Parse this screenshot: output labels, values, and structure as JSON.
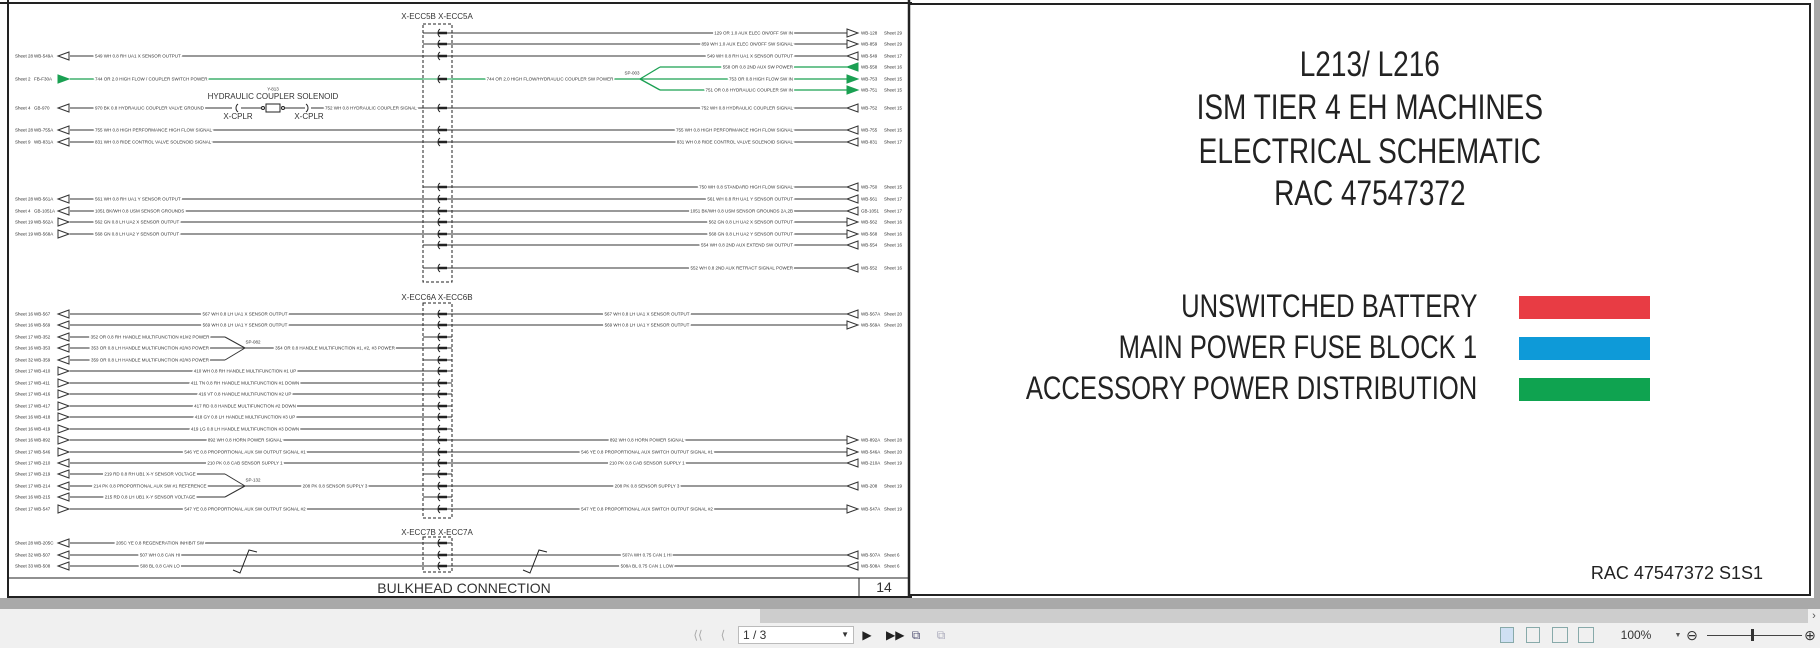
{
  "schematic": {
    "sections": [
      {
        "header": "X-ECC5B X-ECC5A",
        "rows": [
          {
            "right": {
              "wire": "129 OR 1.0 AUX ELEC ON/OFF SW IN",
              "ref": "WB-128",
              "sheet": "Sheet 29",
              "arrow": "out"
            }
          },
          {
            "right": {
              "wire": "859 WH 1.0 AUX ELEC ON/OFF SW SIGNAL",
              "ref": "WB-859",
              "sheet": "Sheet 29",
              "arrow": "out"
            }
          },
          {
            "left": {
              "wire": "549 WH 0.8 RH UA1 X SENSOR OUTPUT",
              "ref": "WB-549A",
              "sheet": "Sheet 28",
              "arrow": "in"
            },
            "right": {
              "wire": "549 WH 0.8 RH UA1 X SENSOR OUTPUT",
              "ref": "WB-549",
              "sheet": "Sheet 17",
              "arrow": "in"
            }
          },
          {
            "color": "green",
            "left": {
              "wire": "744 OR 2.0 HIGH FLOW / COUPLER SWITCH POWER",
              "ref": "FB-F30A",
              "sheet": "Sheet 2",
              "arrow": "fill-out"
            }
          },
          {
            "left": {
              "wire": "970 BK 0.8 HYDRAULIC COUPLER VALVE GROUND",
              "ref": "GB-970",
              "sheet": "Sheet 4",
              "arrow": "in"
            },
            "right": {
              "wire": "752 WH 0.8 HYDRAULIC COUPLER SIGNAL",
              "ref": "WB-752",
              "sheet": "Sheet 15",
              "arrow": "in"
            }
          },
          {
            "left": {
              "wire": "755 WH 0.8 HIGH PERFORMANCE HIGH FLOW SIGNAL",
              "ref": "WB-755A",
              "sheet": "Sheet 28",
              "arrow": "in"
            },
            "right": {
              "wire": "755 WH 0.8 HIGH PERFORMANCE HIGH FLOW SIGNAL",
              "ref": "WB-755",
              "sheet": "Sheet 15",
              "arrow": "in"
            }
          },
          {
            "left": {
              "wire": "831 WH 0.8 RIDE CONTROL VALVE SOLENOID SIGNAL",
              "ref": "WB-831A",
              "sheet": "Sheet 9",
              "arrow": "in"
            },
            "right": {
              "wire": "831 WH 0.8 RIDE CONTROL VALVE SOLENOID SIGNAL",
              "ref": "WB-831",
              "sheet": "Sheet 17",
              "arrow": "in"
            }
          },
          {
            "right": {
              "wire": "750 WH 0.8 STANDARD HIGH FLOW SIGNAL",
              "ref": "WB-750",
              "sheet": "Sheet 15",
              "arrow": "in"
            }
          },
          {
            "left": {
              "wire": "561 WH 0.8 RH UA1 Y SENSOR OUTPUT",
              "ref": "WB-561A",
              "sheet": "Sheet 28",
              "arrow": "in"
            },
            "right": {
              "wire": "561 WH 0.8 RH UA1 Y SENSOR OUTPUT",
              "ref": "WB-561",
              "sheet": "Sheet 17",
              "arrow": "in"
            }
          },
          {
            "left": {
              "wire": "1051 BK/WH 0.8 USM SENSOR GROUNDS",
              "ref": "GB-1051A",
              "sheet": "Sheet 4",
              "arrow": "in"
            },
            "right": {
              "wire": "1051 BK/WH 0.8 USM SENSOR GROUNDS 2A,2B",
              "ref": "GB-1051",
              "sheet": "Sheet 17",
              "arrow": "in"
            }
          },
          {
            "left": {
              "wire": "562 GN 0.8 LH UA2 X SENSOR OUTPUT",
              "ref": "WB-562A",
              "sheet": "Sheet 19",
              "arrow": "out"
            },
            "right": {
              "wire": "562 GN 0.8 LH UA2 X SENSOR OUTPUT",
              "ref": "WB-562",
              "sheet": "Sheet 16",
              "arrow": "out"
            }
          },
          {
            "left": {
              "wire": "568 GN 0.8 LH UA2 Y SENSOR OUTPUT",
              "ref": "WB-568A",
              "sheet": "Sheet 19",
              "arrow": "out"
            },
            "right": {
              "wire": "568 GN 0.8 LH UA2 Y SENSOR OUTPUT",
              "ref": "WB-568",
              "sheet": "Sheet 16",
              "arrow": "out"
            }
          },
          {
            "right": {
              "wire": "554 WH 0.8 2ND AUX EXTEND SW OUTPUT",
              "ref": "WB-554",
              "sheet": "Sheet 16",
              "arrow": "in"
            }
          },
          {
            "right": {
              "wire": "552 WH 0.8 2ND AUX RETRACT SIGNAL POWER",
              "ref": "WB-552",
              "sheet": "Sheet 16",
              "arrow": "in"
            }
          }
        ],
        "splice": {
          "label": "SP-003",
          "trunk_wire": "744 OR 2.0 HIGH FLOW/HYDRAULIC COUPLER SW POWER",
          "branches": [
            {
              "wire": "558 OR 0.8 2ND AUX SW POWER",
              "ref": "WB-558",
              "sheet": "Sheet 16",
              "arrow": "fill-in"
            },
            {
              "wire": "753 OR 0.8 HIGH FLOW SW IN",
              "ref": "WB-753",
              "sheet": "Sheet 15",
              "arrow": "fill-out"
            },
            {
              "wire": "751 OR 0.8 HYDRAULIC COUPLER SW IN",
              "ref": "WB-751",
              "sheet": "Sheet 15",
              "arrow": "fill-out"
            }
          ]
        },
        "solenoid": {
          "ref": "Y-813",
          "name": "HYDRAULIC COUPLER SOLENOID",
          "plug_left": "X-CPLR",
          "plug_right": "X-CPLR",
          "wire_out": "752 WH 0.8 HYDRAULIC COUPLER SIGNAL"
        }
      },
      {
        "header": "X-ECC6A X-ECC6B",
        "rows": [
          {
            "left": {
              "wire": "567 WH 0.8 LH UA1 X SENSOR OUTPUT",
              "ref": "WB-567",
              "sheet": "Sheet 16",
              "arrow": "in"
            },
            "right": {
              "wire": "567 WH 0.8 LH UA1 X SENSOR OUTPUT",
              "ref": "WB-567A",
              "sheet": "Sheet 20",
              "arrow": "in"
            }
          },
          {
            "left": {
              "wire": "569 WH 0.8 LH UA1 Y SENSOR OUTPUT",
              "ref": "WB-569",
              "sheet": "Sheet 16",
              "arrow": "in"
            },
            "right": {
              "wire": "569 WH 0.8 LH UA1 Y SENSOR OUTPUT",
              "ref": "WB-569A",
              "sheet": "Sheet 20",
              "arrow": "out"
            }
          },
          {
            "left": {
              "wire": "352 OR 0.8 RH HANDLE MULTIFUNCTION #1/#2 POWER",
              "ref": "WB-352",
              "sheet": "Sheet 17",
              "arrow": "in",
              "via_splice": 0
            }
          },
          {
            "left": {
              "wire": "353 OR 0.8 LH HANDLE MULTIFUNCTION #2/#3 POWER",
              "ref": "WB-353",
              "sheet": "Sheet 16",
              "arrow": "in",
              "via_splice": 0
            }
          },
          {
            "left": {
              "wire": "359 OR 0.8 LH HANDLE MULTIFUNCTION #2/#3 POWER",
              "ref": "WB-359",
              "sheet": "Sheet 32",
              "arrow": "in",
              "via_splice": 0
            }
          },
          {
            "left": {
              "wire": "410 WH 0.8 RH HANDLE MULTIFUNCTION #1 UP",
              "ref": "WB-410",
              "sheet": "Sheet 17",
              "arrow": "out"
            }
          },
          {
            "left": {
              "wire": "411 TN 0.8 RH HANDLE MULTIFUNCTION #1 DOWN",
              "ref": "WB-411",
              "sheet": "Sheet 17",
              "arrow": "out"
            }
          },
          {
            "left": {
              "wire": "416 VT 0.8 HANDLE MULTIFUNCTION #2 UP",
              "ref": "WB-416",
              "sheet": "Sheet 17",
              "arrow": "out"
            }
          },
          {
            "left": {
              "wire": "417 RD 0.8 HANDLE MULTIFUNCTION #2 DOWN",
              "ref": "WB-417",
              "sheet": "Sheet 17",
              "arrow": "out"
            }
          },
          {
            "left": {
              "wire": "418 GY 0.8 LH HANDLE MULTIFUNCTION #3 UP",
              "ref": "WB-418",
              "sheet": "Sheet 16",
              "arrow": "out"
            }
          },
          {
            "left": {
              "wire": "419 LG 0.8 LH HANDLE MULTIFUNCTION #3 DOWN",
              "ref": "WB-419",
              "sheet": "Sheet 16",
              "arrow": "out"
            }
          },
          {
            "left": {
              "wire": "892 WH 0.8 HORN POWER SIGNAL",
              "ref": "WB-892",
              "sheet": "Sheet 16",
              "arrow": "out"
            },
            "right": {
              "wire": "892 WH 0.8 HORN POWER SIGNAL",
              "ref": "WB-892A",
              "sheet": "Sheet 28",
              "arrow": "out"
            }
          },
          {
            "left": {
              "wire": "546 YE 0.8 PROPORTIONAL AUX SW OUTPUT SIGNAL #1",
              "ref": "WB-546",
              "sheet": "Sheet 17",
              "arrow": "out"
            },
            "right": {
              "wire": "546 YE 0.8 PROPORTIONAL AUX SWITCH OUTPUT SIGNAL #1",
              "ref": "WB-546A",
              "sheet": "Sheet 20",
              "arrow": "out"
            }
          },
          {
            "left": {
              "wire": "210 PK 0.8 CAB SENSOR SUPPLY 1",
              "ref": "WB-210",
              "sheet": "Sheet 17",
              "arrow": "in"
            },
            "right": {
              "wire": "210 PK 0.8 CAB SENSOR SUPPLY 1",
              "ref": "WB-210A",
              "sheet": "Sheet 19",
              "arrow": "in"
            }
          },
          {
            "left": {
              "wire": "219 RD 0.8 RH UB1 X-Y SENSOR VOLTAGE",
              "ref": "WB-219",
              "sheet": "Sheet 17",
              "arrow": "in",
              "via_splice": 1
            }
          },
          {
            "left": {
              "wire": "214 PK 0.8 PROPORTIONAL AUX SW #1 REFERENCE",
              "ref": "WB-214",
              "sheet": "Sheet 17",
              "arrow": "in",
              "via_splice": 1
            },
            "right": {
              "wire": "208 PK 0.8 SENSOR SUPPLY 3",
              "ref": "WB-208",
              "sheet": "Sheet 19",
              "arrow": "in"
            }
          },
          {
            "left": {
              "wire": "215 RD 0.8 LH UB1 X-Y SENSOR VOLTAGE",
              "ref": "WB-215",
              "sheet": "Sheet 16",
              "arrow": "in",
              "via_splice": 1
            }
          },
          {
            "left": {
              "wire": "547 YE 0.8 PROPORTIONAL AUX SW OUTPUT SIGNAL #2",
              "ref": "WB-547",
              "sheet": "Sheet 17",
              "arrow": "out"
            },
            "right": {
              "wire": "547 YE 0.8 PROPORTIONAL AUX SWITCH OUTPUT SIGNAL #2",
              "ref": "WB-547A",
              "sheet": "Sheet 19",
              "arrow": "out"
            }
          }
        ],
        "splices": [
          {
            "label": "SP-082",
            "trunk_wire": "354 OR 0.8 HANDLE MULTIFUNCTION #1, #2, #3 POWER"
          },
          {
            "label": "SP-132",
            "trunk_wire": "208 PK 0.8 SENSOR SUPPLY 3"
          }
        ]
      },
      {
        "header": "X-ECC7B X-ECC7A",
        "rows": [
          {
            "left": {
              "wire": "205C YE 0.8 REGENERATION INHIBIT SW",
              "ref": "WB-205C",
              "sheet": "Sheet 28",
              "arrow": "in"
            }
          },
          {
            "left": {
              "wire": "507 WH 0.8 CAN HI",
              "ref": "WB-507",
              "sheet": "Sheet 32",
              "arrow": "in"
            },
            "right": {
              "wire": "507A WH 0.75 CAN 1 HI",
              "ref": "WB-507A",
              "sheet": "Sheet 6",
              "arrow": "in"
            }
          },
          {
            "left": {
              "wire": "508 BL 0.8 CAN LO",
              "ref": "WB-508",
              "sheet": "Sheet 33",
              "arrow": "in"
            },
            "right": {
              "wire": "508A BL 0.75 CAN 1 LOW",
              "ref": "WB-508A",
              "sheet": "Sheet 6",
              "arrow": "in"
            }
          }
        ]
      }
    ],
    "title_block": {
      "title": "BULKHEAD CONNECTION",
      "page_number": "14"
    },
    "colors": {
      "wire": "#333333",
      "green": "#1aa052"
    }
  },
  "cover": {
    "title_lines": [
      "L213/ L216",
      "ISM TIER 4 EH MACHINES",
      "ELECTRICAL SCHEMATIC",
      "RAC 47547372"
    ],
    "legend": [
      {
        "label": "UNSWITCHED BATTERY",
        "color": "#e83c44"
      },
      {
        "label": "MAIN POWER FUSE BLOCK 1",
        "color": "#0e9ad8"
      },
      {
        "label": "ACCESSORY POWER DISTRIBUTION",
        "color": "#0fa350"
      }
    ],
    "sheet_id": "RAC 47547372 S1S1"
  },
  "toolbar": {
    "page_value": "1 / 3",
    "zoom_value": "100%",
    "zoom_fraction": 0.47,
    "icons": [
      "first-page-icon",
      "previous-page-icon",
      "next-page-icon",
      "last-page-icon",
      "previous-view-icon",
      "next-view-icon",
      "single-page-icon",
      "continuous-icon",
      "facing-icon",
      "continuous-facing-icon",
      "zoom-out-icon",
      "zoom-in-icon"
    ]
  }
}
